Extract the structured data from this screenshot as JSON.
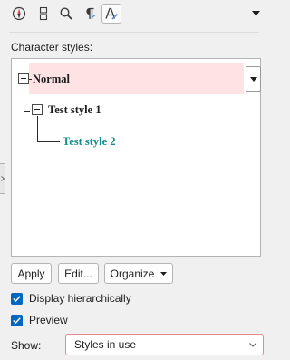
{
  "toolbar": {
    "buttons": [
      {
        "icon": "navigator-compass-icon",
        "active": false
      },
      {
        "icon": "frame-styles-icon",
        "active": false
      },
      {
        "icon": "find-icon",
        "active": false
      },
      {
        "icon": "paragraph-styles-icon",
        "active": false
      },
      {
        "icon": "character-styles-icon",
        "active": true
      }
    ],
    "menu_icon": "triangle-down-icon"
  },
  "panel": {
    "section_label": "Character styles:",
    "tree": [
      {
        "label": "Normal",
        "level": 0,
        "selected": true,
        "expanded": true,
        "color": "#1e1e1e"
      },
      {
        "label": "Test style 1",
        "level": 1,
        "selected": false,
        "expanded": true,
        "color": "#1e1e1e"
      },
      {
        "label": "Test style 2",
        "level": 2,
        "selected": false,
        "expanded": false,
        "color": "#148a8a"
      }
    ],
    "selection_color": "#fde3e3"
  },
  "buttons": {
    "apply": "Apply",
    "edit": "Edit...",
    "organize": "Organize"
  },
  "options": {
    "display_hierarchically": {
      "label": "Display hierarchically",
      "checked": true
    },
    "preview": {
      "label": "Preview",
      "checked": true
    }
  },
  "show": {
    "label": "Show:",
    "value": "Styles in use"
  },
  "colors": {
    "accent": "#0067c0",
    "focus_border": "#e38a8a"
  }
}
